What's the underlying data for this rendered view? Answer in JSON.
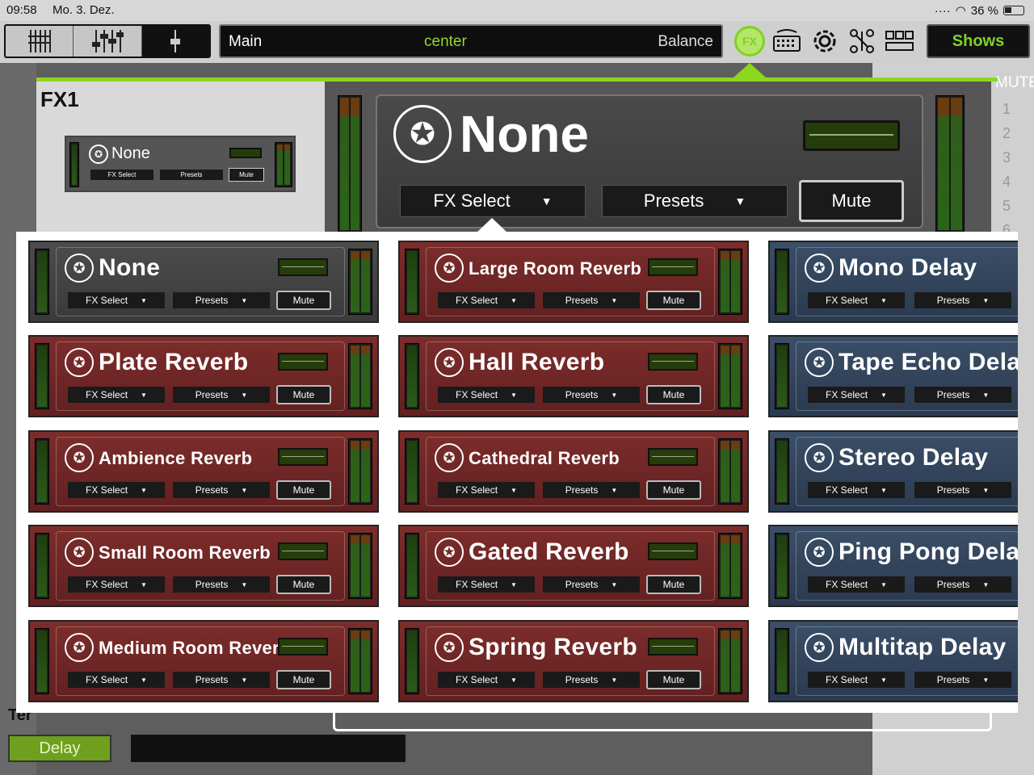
{
  "status": {
    "time": "09:58",
    "date": "Mo. 3. Dez.",
    "battery": "36 %"
  },
  "toolbar": {
    "channel": "Main",
    "pan": "center",
    "balance": "Balance",
    "fx_label": "FX",
    "shows": "Shows"
  },
  "background": {
    "mute_label": "MUTE",
    "numbers": [
      "1",
      "2",
      "3",
      "4",
      "5",
      "6"
    ],
    "ten_label": "Ter",
    "delay_button": "Delay"
  },
  "fx1": {
    "title": "FX1",
    "effect_name": "None",
    "fx_select": "FX Select",
    "presets": "Presets",
    "mute": "Mute",
    "mini": {
      "name": "None",
      "fx_select": "FX Select",
      "presets": "Presets",
      "mute": "Mute"
    }
  },
  "popup": {
    "buttons": {
      "fx_select": "FX Select",
      "presets": "Presets",
      "mute": "Mute"
    },
    "effects": [
      {
        "name": "None",
        "color": "gray"
      },
      {
        "name": "Large Room Reverb",
        "color": "red"
      },
      {
        "name": "Mono Delay",
        "color": "blue"
      },
      {
        "name": "Plate Reverb",
        "color": "red"
      },
      {
        "name": "Hall Reverb",
        "color": "red"
      },
      {
        "name": "Tape Echo Delay",
        "color": "blue"
      },
      {
        "name": "Ambience Reverb",
        "color": "red"
      },
      {
        "name": "Cathedral Reverb",
        "color": "red"
      },
      {
        "name": "Stereo Delay",
        "color": "blue"
      },
      {
        "name": "Small Room Reverb",
        "color": "red"
      },
      {
        "name": "Gated Reverb",
        "color": "red"
      },
      {
        "name": "Ping Pong Delay",
        "color": "blue"
      },
      {
        "name": "Medium Room Reverb",
        "color": "red"
      },
      {
        "name": "Spring Reverb",
        "color": "red"
      },
      {
        "name": "Multitap Delay",
        "color": "blue"
      }
    ]
  },
  "colors": {
    "accent_green": "#8cd81e",
    "reverb_red": "#6e2624",
    "delay_blue": "#33465e"
  }
}
